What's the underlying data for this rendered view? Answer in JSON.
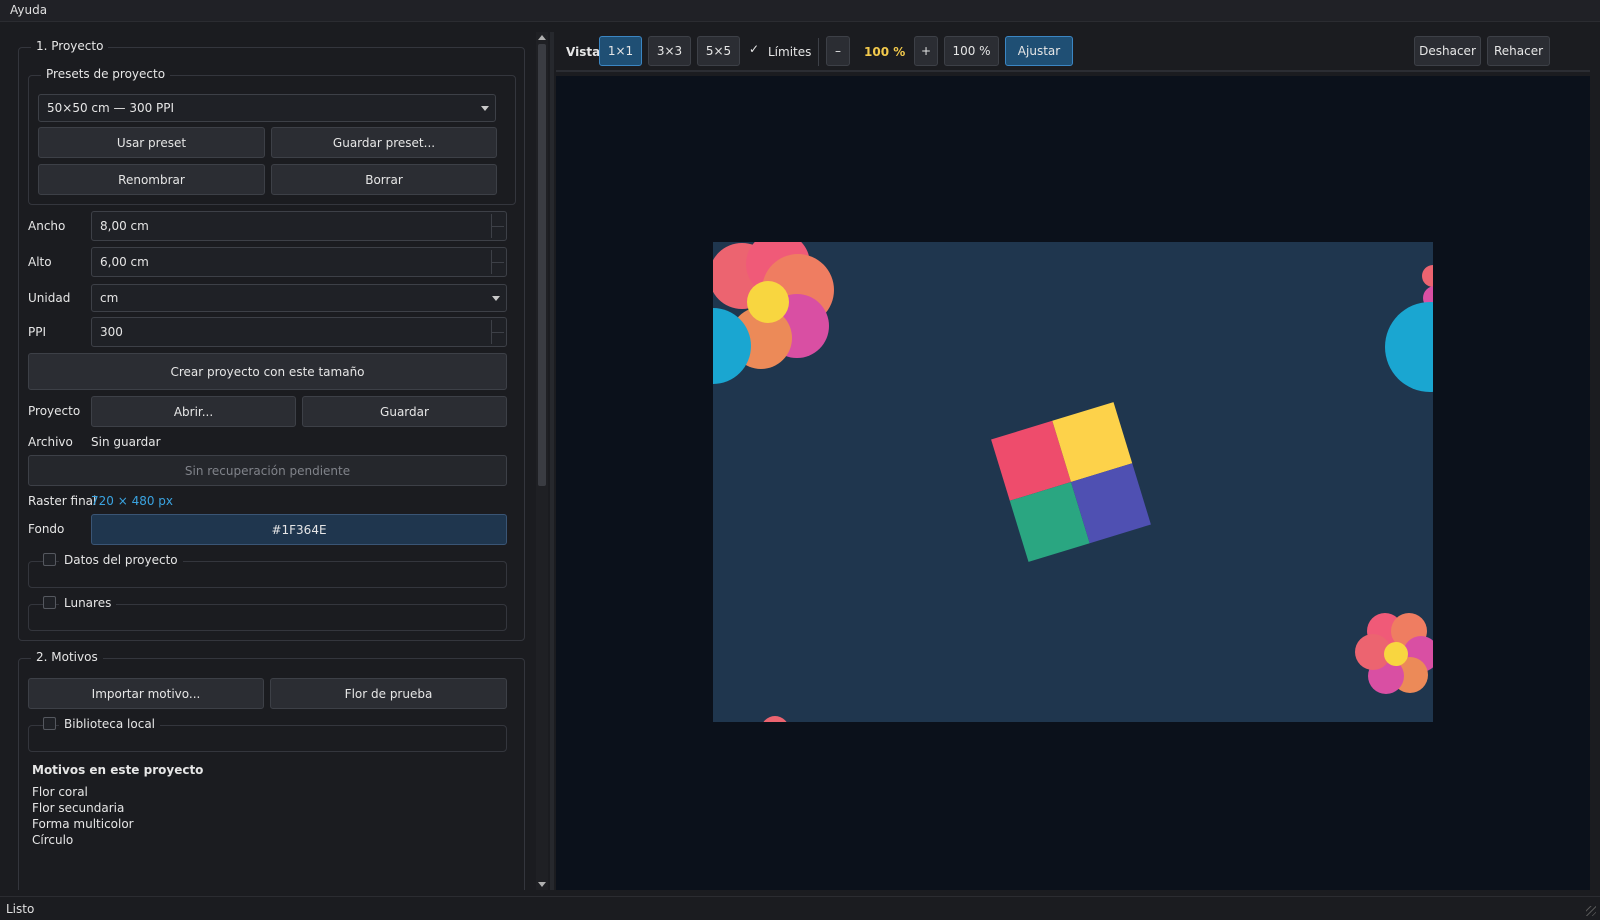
{
  "menubar": {
    "help": "Ayuda"
  },
  "project": {
    "section_title": "1. Proyecto",
    "presets_title": "Presets de proyecto",
    "preset_selected": "50×50 cm — 300 PPI",
    "use_preset": "Usar preset",
    "save_preset": "Guardar preset...",
    "rename": "Renombrar",
    "delete": "Borrar",
    "width_label": "Ancho",
    "width_value": "8,00 cm",
    "height_label": "Alto",
    "height_value": "6,00 cm",
    "unit_label": "Unidad",
    "unit_value": "cm",
    "ppi_label": "PPI",
    "ppi_value": "300",
    "create_button": "Crear proyecto con este tamaño",
    "project_label": "Proyecto",
    "open_button": "Abrir...",
    "save_button": "Guardar",
    "file_label": "Archivo",
    "file_value": "Sin guardar",
    "recovery_button": "Sin recuperación pendiente",
    "raster_label": "Raster final",
    "raster_value": "720 × 480 px",
    "raster_color": "#3aa3e0",
    "background_label": "Fondo",
    "background_value": "#1F364E",
    "project_data_title": "Datos del proyecto",
    "dots_title": "Lunares"
  },
  "motifs": {
    "section_title": "2. Motivos",
    "import_button": "Importar motivo...",
    "test_flower_button": "Flor de prueba",
    "local_library_title": "Biblioteca local",
    "in_project_title": "Motivos en este proyecto",
    "items": [
      "Flor coral",
      "Flor secundaria",
      "Forma multicolor",
      "Círculo"
    ]
  },
  "toolbar": {
    "view_label": "Vista",
    "view_1x1": "1×1",
    "view_3x3": "3×3",
    "view_5x5": "5×5",
    "bounds_label": "Límites",
    "bounds_checked": true,
    "zoom_out": "–",
    "zoom_value": "100 %",
    "zoom_in": "+",
    "zoom_reset": "100 %",
    "fit": "Ajustar",
    "undo": "Deshacer",
    "redo": "Rehacer",
    "zoom_color": "#f2c94c"
  },
  "canvas": {
    "background_color": "#1F364E",
    "viewport_color": "#0b111b",
    "motif_names": [
      "flower-top-left",
      "flower-bottom-right",
      "multicolor-square",
      "circle-right"
    ]
  },
  "status": {
    "text": "Listo"
  }
}
